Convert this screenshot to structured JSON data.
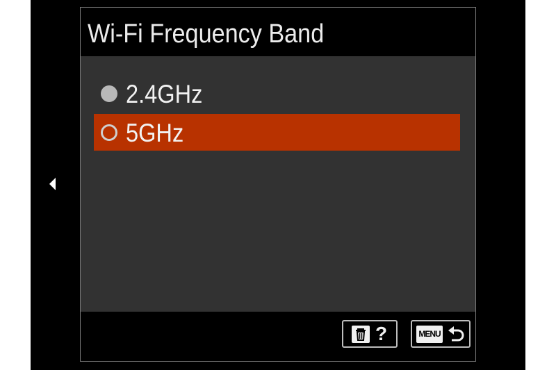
{
  "header": {
    "title": "Wi-Fi Frequency Band"
  },
  "options": [
    {
      "label": "2.4GHz",
      "selected": false
    },
    {
      "label": "5GHz",
      "selected": true
    }
  ],
  "footer": {
    "help_label": "?",
    "menu_label": "MENU"
  },
  "icons": {
    "page_prev": "left-arrow-icon",
    "delete": "trash-icon",
    "back": "return-arrow-icon"
  },
  "colors": {
    "highlight": "#b83200",
    "content_background": "#323232",
    "text": "#f2f2f2"
  }
}
